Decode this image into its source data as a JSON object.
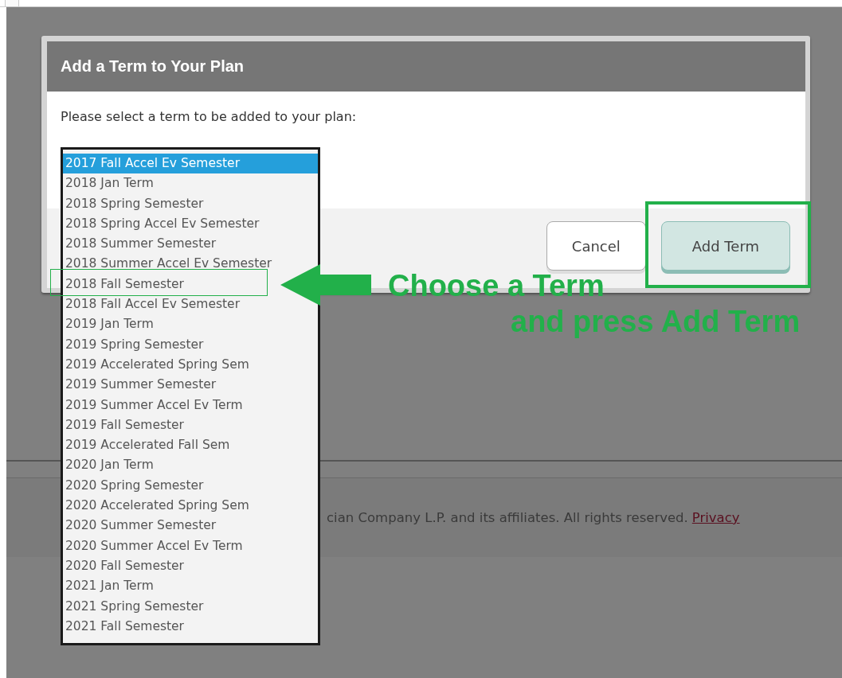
{
  "dialog": {
    "title": "Add a Term to Your Plan",
    "prompt": "Please select a term to be added to your plan:",
    "buttons": [
      {
        "label": "Cancel",
        "kind": "secondary"
      },
      {
        "label": "Add Term",
        "kind": "primary"
      }
    ]
  },
  "term_list": {
    "items": [
      {
        "label": "2017 Fall Accel Ev Semester",
        "selected": true
      },
      {
        "label": "2018 Jan Term",
        "selected": false
      },
      {
        "label": "2018 Spring Semester",
        "selected": false
      },
      {
        "label": "2018 Spring Accel Ev Semester",
        "selected": false
      },
      {
        "label": "2018 Summer Semester",
        "selected": false
      },
      {
        "label": "2018 Summer Accel Ev Semester",
        "selected": false
      },
      {
        "label": "2018 Fall Semester",
        "selected": false
      },
      {
        "label": "2018 Fall Accel Ev Semester",
        "selected": false
      },
      {
        "label": "2019 Jan Term",
        "selected": false
      },
      {
        "label": "2019 Spring Semester",
        "selected": false
      },
      {
        "label": "2019 Accelerated Spring Sem",
        "selected": false
      },
      {
        "label": "2019 Summer Semester",
        "selected": false
      },
      {
        "label": "2019 Summer Accel Ev Term",
        "selected": false
      },
      {
        "label": "2019 Fall Semester",
        "selected": false
      },
      {
        "label": "2019 Accelerated Fall Sem",
        "selected": false
      },
      {
        "label": "2020 Jan Term",
        "selected": false
      },
      {
        "label": "2020 Spring Semester",
        "selected": false
      },
      {
        "label": "2020 Accelerated Spring Sem",
        "selected": false
      },
      {
        "label": "2020 Summer Semester",
        "selected": false
      },
      {
        "label": "2020 Summer Accel Ev Term",
        "selected": false
      },
      {
        "label": "2020 Fall Semester",
        "selected": false
      },
      {
        "label": "2021 Jan Term",
        "selected": false
      },
      {
        "label": "2021 Spring Semester",
        "selected": false
      },
      {
        "label": "2021 Fall Semester",
        "selected": false
      }
    ]
  },
  "footer": {
    "copyright": "cian Company L.P. and its affiliates. All rights reserved.",
    "link": "Privacy"
  },
  "annotations": {
    "line_1": "Choose a Term",
    "line_2": "and press Add Term"
  }
}
